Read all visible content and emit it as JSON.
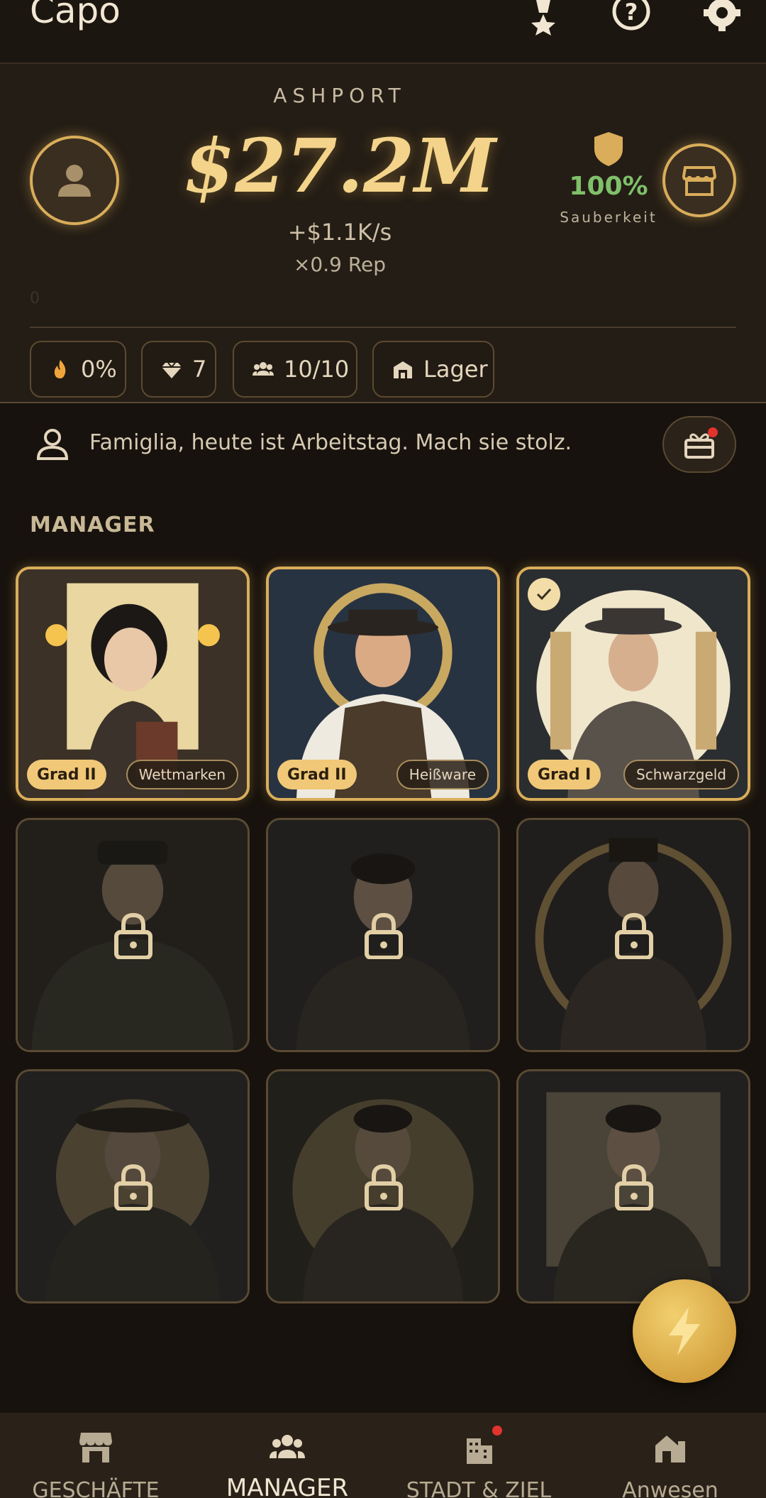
{
  "app": {
    "title": "Capo"
  },
  "topbar": {
    "icons": [
      "medal-icon",
      "help-icon",
      "settings-icon"
    ]
  },
  "header": {
    "city": "ASHPORT",
    "money": "$27.2M",
    "rate": "+$1.1K/s",
    "rep": "×0.9 Rep",
    "cleanliness": {
      "value": "100%",
      "label": "Sauberkeit"
    },
    "hidden_counter": "0"
  },
  "chips": [
    {
      "icon": "flame-icon",
      "label": "0%"
    },
    {
      "icon": "diamond-icon",
      "label": "7"
    },
    {
      "icon": "people-icon",
      "label": "10/10"
    },
    {
      "icon": "warehouse-icon",
      "label": "Lager"
    }
  ],
  "message": {
    "text": "Famiglia, heute ist Arbeitstag. Mach sie stolz."
  },
  "section": {
    "title": "MANAGER"
  },
  "managers": [
    {
      "grade": "Grad II",
      "specialty": "Wettmarken",
      "unlocked": true,
      "selected": false
    },
    {
      "grade": "Grad II",
      "specialty": "Heißware",
      "unlocked": true,
      "selected": false
    },
    {
      "grade": "Grad I",
      "specialty": "Schwarzgeld",
      "unlocked": true,
      "selected": true
    },
    {
      "unlocked": false
    },
    {
      "unlocked": false
    },
    {
      "unlocked": false
    },
    {
      "unlocked": false
    },
    {
      "unlocked": false
    },
    {
      "unlocked": false
    }
  ],
  "nav": [
    {
      "label": "GESCHÄFTE",
      "icon": "store-icon",
      "active": false,
      "badge": false
    },
    {
      "label": "MANAGER",
      "icon": "group-icon",
      "active": true,
      "badge": false
    },
    {
      "label": "STADT & ZIEL",
      "icon": "city-icon",
      "active": false,
      "badge": true
    },
    {
      "label": "Anwesen",
      "icon": "estate-icon",
      "active": false,
      "badge": false
    }
  ],
  "colors": {
    "accent": "#d9ad5a",
    "money": "#f3d48a",
    "clean": "#7fc06a",
    "badge": "#e0342c"
  }
}
